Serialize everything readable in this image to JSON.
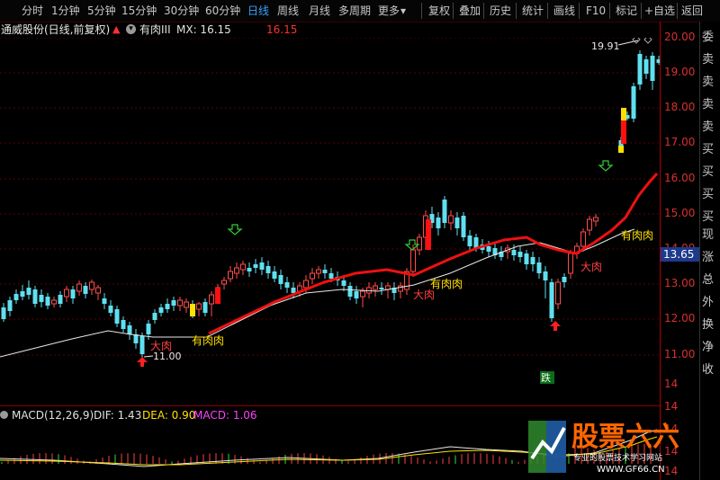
{
  "toolbar": {
    "periods": [
      "分时",
      "1分钟",
      "5分钟",
      "15分钟",
      "30分钟",
      "60分钟",
      "日线",
      "周线",
      "月线",
      "多周期",
      "更多"
    ],
    "active_period": "日线",
    "actions": [
      "复权",
      "叠加",
      "历史",
      "统计",
      "画线",
      "F10",
      "标记",
      "+自选",
      "返回"
    ]
  },
  "infobar": {
    "stock_name": "通威股份(日线,前复权)",
    "indicator": "有肉III",
    "mx_label": "MX: 16.15",
    "value_right": "16.15"
  },
  "price_axis": {
    "labels": [
      "20.00",
      "19.00",
      "18.00",
      "17.00",
      "16.00",
      "15.00",
      "14.00",
      "13.00",
      "12.00",
      "11.00"
    ],
    "current_price": "13.65",
    "macd_labels": [
      "14",
      "14",
      "14",
      "14",
      "14"
    ]
  },
  "side_panel": {
    "items": [
      "委",
      "卖",
      "卖",
      "卖",
      "卖",
      "买",
      "买",
      "买",
      "买",
      "现",
      "涨",
      "总",
      "外",
      "换",
      "净",
      "收"
    ]
  },
  "annotations": {
    "high": "19.91",
    "low": "11.00",
    "da_rou": "大肉",
    "you_rou_rou": "有肉肉",
    "die": "跌"
  },
  "macd": {
    "title": "MACD(12,26,9)",
    "dif": "DIF: 1.43",
    "dea": "DEA: 0.90",
    "macd": "MACD: 1.06"
  },
  "colors": {
    "up": "#ff4d4d",
    "down": "#5fe0f0",
    "ma_line": "#e8e8e8",
    "signal_line": "#ee1111",
    "yellow": "#ffe000",
    "green_signal": "#33cc33"
  },
  "watermark": {
    "title": "股票六六",
    "subtitle": "专业的股票技术学习网站",
    "url": "WWW.GF66.CN"
  }
}
